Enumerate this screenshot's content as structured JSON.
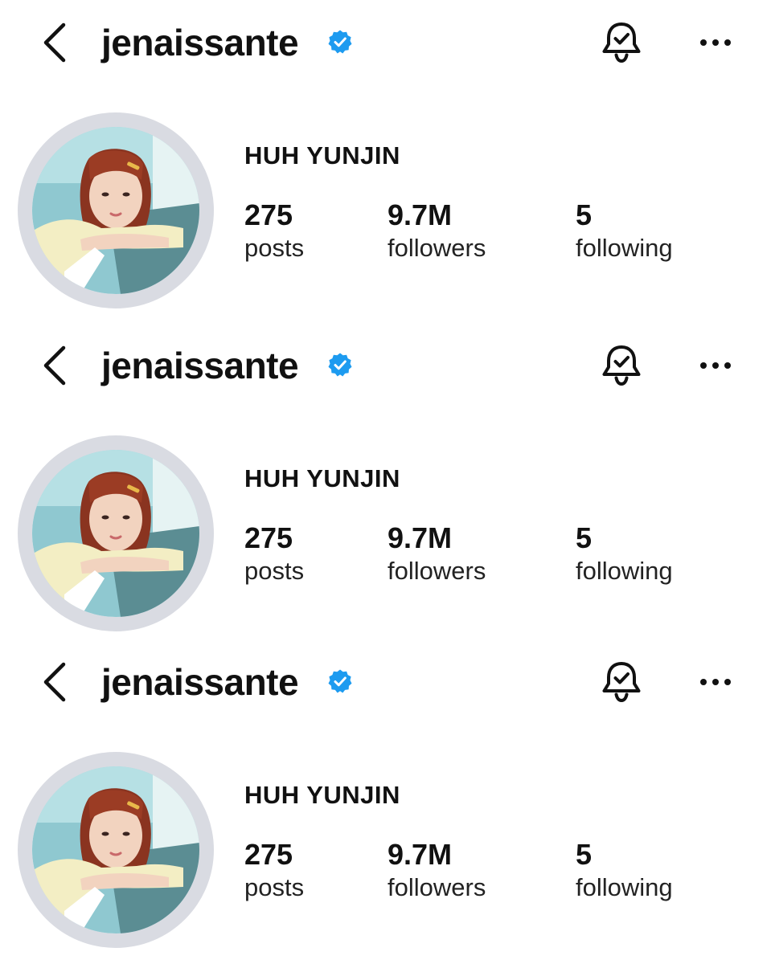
{
  "header": {
    "username": "jenaissante",
    "back_icon": "chevron-left-icon",
    "verified_icon": "verified-badge-icon",
    "notifications_icon": "bell-check-icon",
    "more_icon": "more-horizontal-icon"
  },
  "profile": {
    "full_name": "HUH YUNJIN",
    "avatar": "profile-photo"
  },
  "stats": {
    "posts": {
      "count": "275",
      "label": "posts"
    },
    "followers": {
      "count": "9.7M",
      "label": "followers"
    },
    "following": {
      "count": "5",
      "label": "following"
    }
  },
  "colors": {
    "verified": "#1d9bf0",
    "text": "#111111",
    "avatar_ring": "#d9dbe2",
    "background": "#ffffff"
  }
}
